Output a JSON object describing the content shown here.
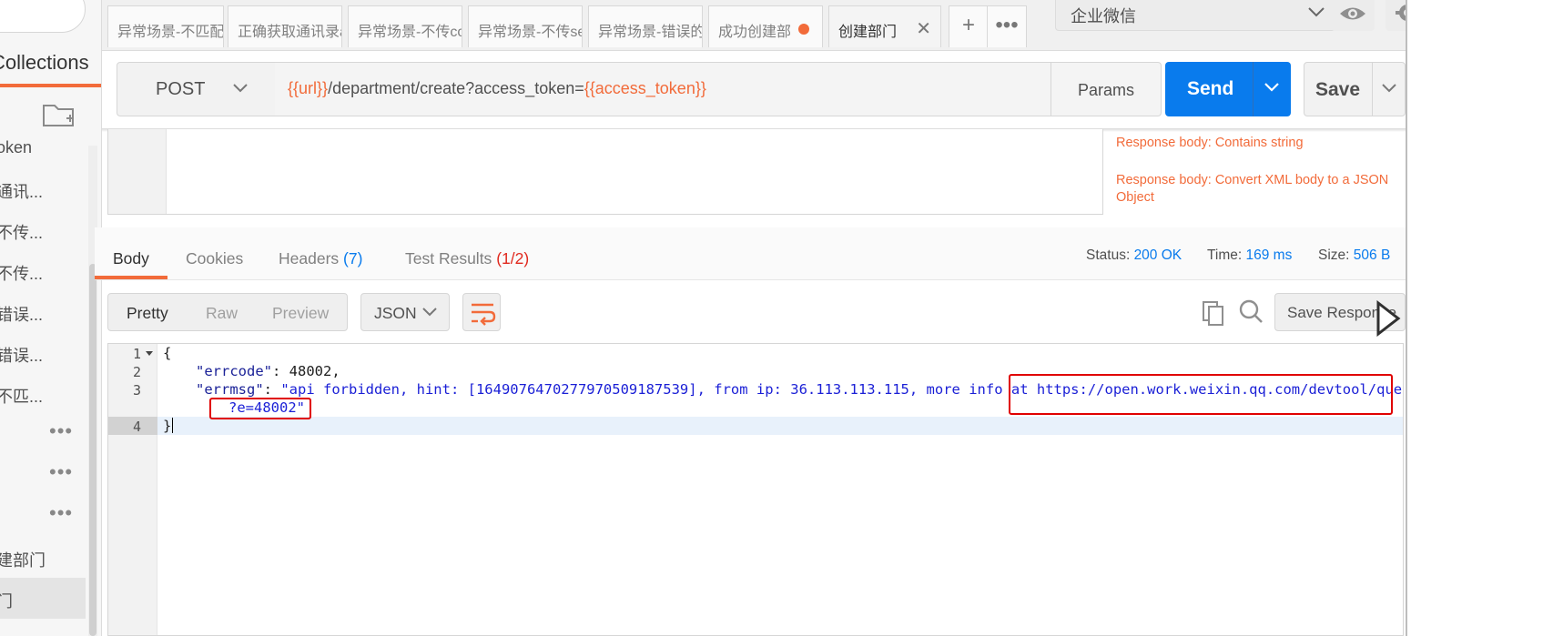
{
  "sidebar": {
    "section_title": "Collections",
    "items": [
      {
        "label": "oken"
      },
      {
        "label": "通讯..."
      },
      {
        "label": "不传..."
      },
      {
        "label": "不传..."
      },
      {
        "label": "错误..."
      },
      {
        "label": "错误..."
      },
      {
        "label": "不匹..."
      },
      {
        "label": "•••"
      },
      {
        "label": "•••"
      },
      {
        "label": "•••"
      },
      {
        "label": "建部门"
      },
      {
        "label": "门"
      }
    ]
  },
  "tabs": [
    {
      "label": "异常场景-不匹配的"
    },
    {
      "label": "正确获取通讯录a"
    },
    {
      "label": "异常场景-不传cor"
    },
    {
      "label": "异常场景-不传sec"
    },
    {
      "label": "异常场景-错误的c"
    },
    {
      "label": "成功创建部"
    },
    {
      "label": "创建部门"
    }
  ],
  "tab_plus": "+",
  "tab_more": "•••",
  "environment": {
    "selected": "企业微信"
  },
  "request": {
    "method": "POST",
    "url_var1": "{{url}}",
    "url_path": "/department/create?access_token=",
    "url_var2": "{{access_token}}",
    "params_label": "Params",
    "send_label": "Send",
    "save_label": "Save"
  },
  "snippets": [
    "Response body: Contains string",
    "Response body: Convert XML body to a JSON Object"
  ],
  "response_tabs": {
    "body": "Body",
    "cookies": "Cookies",
    "headers": "Headers",
    "headers_count": "(7)",
    "tests": "Test Results",
    "tests_count": "(1/2)"
  },
  "status": {
    "status_label": "Status:",
    "status_value": "200 OK",
    "time_label": "Time:",
    "time_value": "169 ms",
    "size_label": "Size:",
    "size_value": "506 B"
  },
  "format": {
    "pretty": "Pretty",
    "raw": "Raw",
    "preview": "Preview",
    "language": "JSON",
    "save_response": "Save Response"
  },
  "code": {
    "line_numbers": [
      "1",
      "2",
      "3",
      "4"
    ],
    "l1": "{",
    "l2_key": "\"errcode\"",
    "l2_colon": ": ",
    "l2_val": "48002",
    "l2_comma": ",",
    "l3_key": "\"errmsg\"",
    "l3_colon": ": ",
    "l3_val_a": "\"api forbidden, hint: [1649076470277970509187539], from ip: 36.113.113.115, more info at https://open.work.weixin.qq.com/devtool/query",
    "l3_val_b": "?e=48002\"",
    "l4": "}"
  },
  "colors": {
    "accent_orange": "#f26b3a",
    "send_blue": "#097bed",
    "error_red": "#e0291e",
    "annotation_red": "#e00000"
  }
}
